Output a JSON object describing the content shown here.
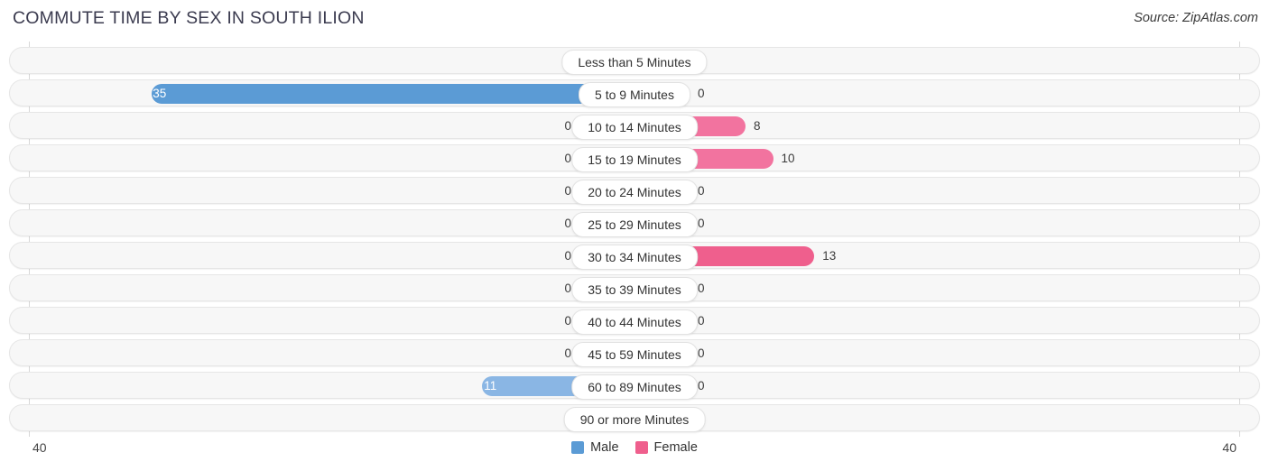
{
  "header": {
    "title": "COMMUTE TIME BY SEX IN SOUTH ILION",
    "source": "Source: ZipAtlas.com"
  },
  "legend": {
    "male_label": "Male",
    "female_label": "Female",
    "male_color": "#5b9bd5",
    "female_color": "#ef5f8d"
  },
  "axis": {
    "left_tick": "40",
    "right_tick": "40",
    "max": 40
  },
  "chart_data": {
    "type": "bar",
    "title": "COMMUTE TIME BY SEX IN SOUTH ILION",
    "xlabel": "",
    "ylabel": "",
    "orientation": "horizontal",
    "layout": "diverging-bidirectional",
    "grid": false,
    "legend_position": "bottom-center",
    "axis_max_each_side": 40,
    "xlim": [
      40,
      40
    ],
    "categories": [
      "Less than 5 Minutes",
      "5 to 9 Minutes",
      "10 to 14 Minutes",
      "15 to 19 Minutes",
      "20 to 24 Minutes",
      "25 to 29 Minutes",
      "30 to 34 Minutes",
      "35 to 39 Minutes",
      "40 to 44 Minutes",
      "45 to 59 Minutes",
      "60 to 89 Minutes",
      "90 or more Minutes"
    ],
    "series": [
      {
        "name": "Male",
        "color": "#5b9bd5",
        "direction": "left",
        "values": [
          0,
          35,
          0,
          0,
          0,
          0,
          0,
          0,
          0,
          0,
          11,
          0
        ]
      },
      {
        "name": "Female",
        "color": "#ef5f8d",
        "direction": "right",
        "values": [
          0,
          0,
          8,
          10,
          0,
          0,
          13,
          0,
          0,
          0,
          0,
          0
        ]
      }
    ]
  },
  "rows": [
    {
      "label": "Less than 5 Minutes",
      "male": "0",
      "female": "0"
    },
    {
      "label": "5 to 9 Minutes",
      "male": "35",
      "female": "0"
    },
    {
      "label": "10 to 14 Minutes",
      "male": "0",
      "female": "8"
    },
    {
      "label": "15 to 19 Minutes",
      "male": "0",
      "female": "10"
    },
    {
      "label": "20 to 24 Minutes",
      "male": "0",
      "female": "0"
    },
    {
      "label": "25 to 29 Minutes",
      "male": "0",
      "female": "0"
    },
    {
      "label": "30 to 34 Minutes",
      "male": "0",
      "female": "13"
    },
    {
      "label": "35 to 39 Minutes",
      "male": "0",
      "female": "0"
    },
    {
      "label": "40 to 44 Minutes",
      "male": "0",
      "female": "0"
    },
    {
      "label": "45 to 59 Minutes",
      "male": "0",
      "female": "0"
    },
    {
      "label": "60 to 89 Minutes",
      "male": "11",
      "female": "0"
    },
    {
      "label": "90 or more Minutes",
      "male": "0",
      "female": "0"
    }
  ]
}
